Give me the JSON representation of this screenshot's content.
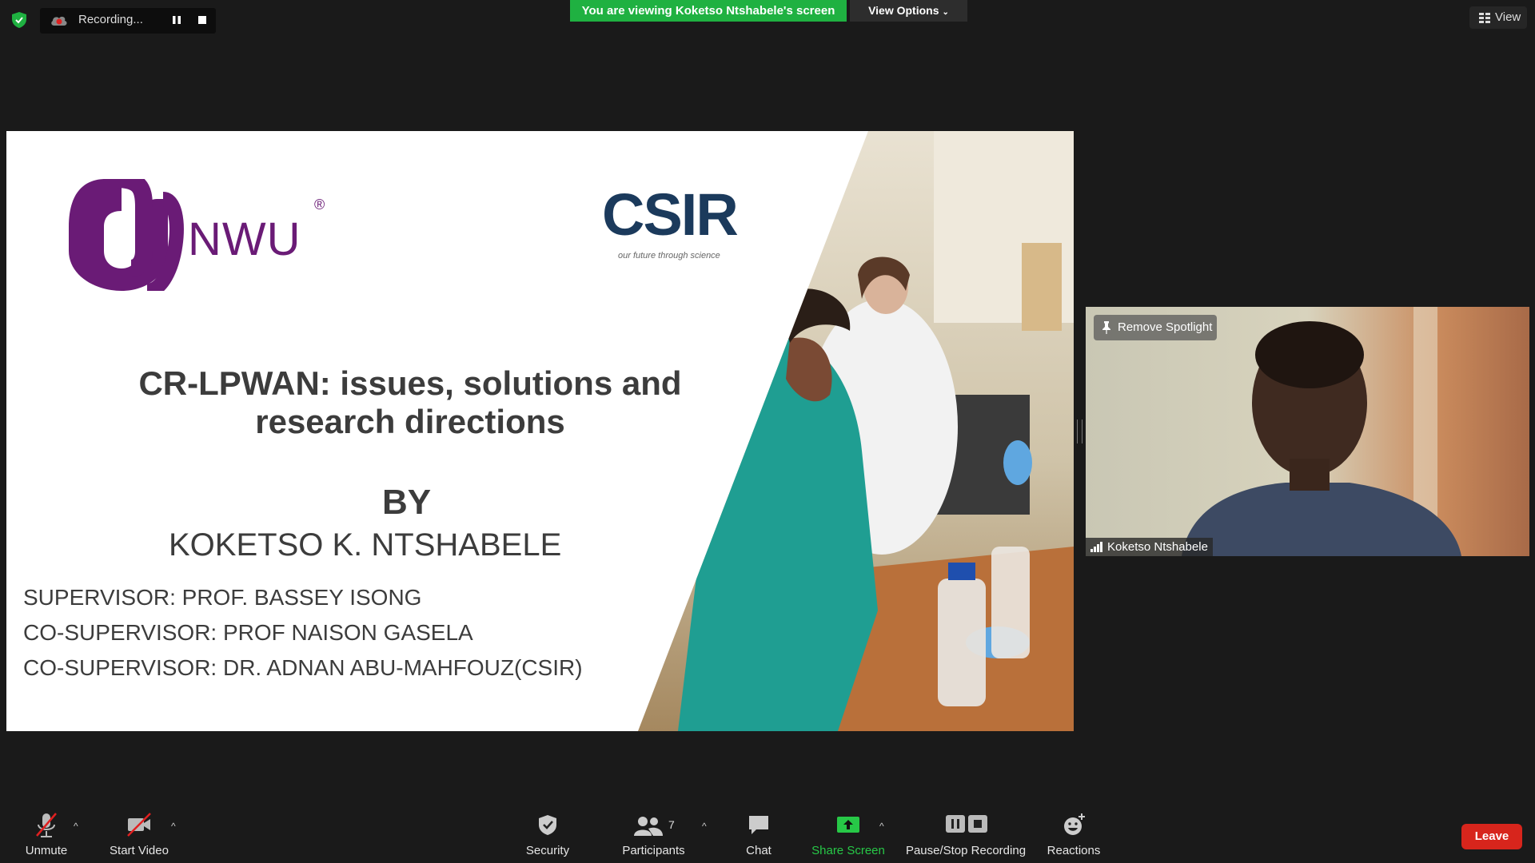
{
  "top_bar": {
    "recording_label": "Recording...",
    "viewing_banner": "You are viewing Koketso Ntshabele's screen",
    "view_options_label": "View Options",
    "view_label": "View"
  },
  "slide": {
    "nwu_logo_text": "NWU",
    "nwu_reg_mark": "®",
    "csir_logo_text": "CSIR",
    "csir_tagline": "our future through science",
    "title": "CR-LPWAN: issues, solutions and research directions",
    "by": "BY",
    "author": "KOKETSO K. NTSHABELE",
    "supervisors": [
      "SUPERVISOR: PROF. BASSEY ISONG",
      "CO-SUPERVISOR:  PROF NAISON GASELA",
      "CO-SUPERVISOR: DR. ADNAN ABU-MAHFOUZ(CSIR)"
    ]
  },
  "video": {
    "remove_spotlight_label": "Remove Spotlight",
    "participant_name": "Koketso Ntshabele"
  },
  "toolbar": {
    "unmute": "Unmute",
    "start_video": "Start Video",
    "security": "Security",
    "participants": "Participants",
    "participants_count": "7",
    "chat": "Chat",
    "share_screen": "Share Screen",
    "pause_stop_recording": "Pause/Stop Recording",
    "reactions": "Reactions",
    "leave": "Leave"
  },
  "colors": {
    "banner_green": "#1fb141",
    "share_green": "#27c847",
    "leave_red": "#d7251c",
    "nwu_purple": "#6a1b76",
    "csir_navy": "#1b3a5c"
  }
}
